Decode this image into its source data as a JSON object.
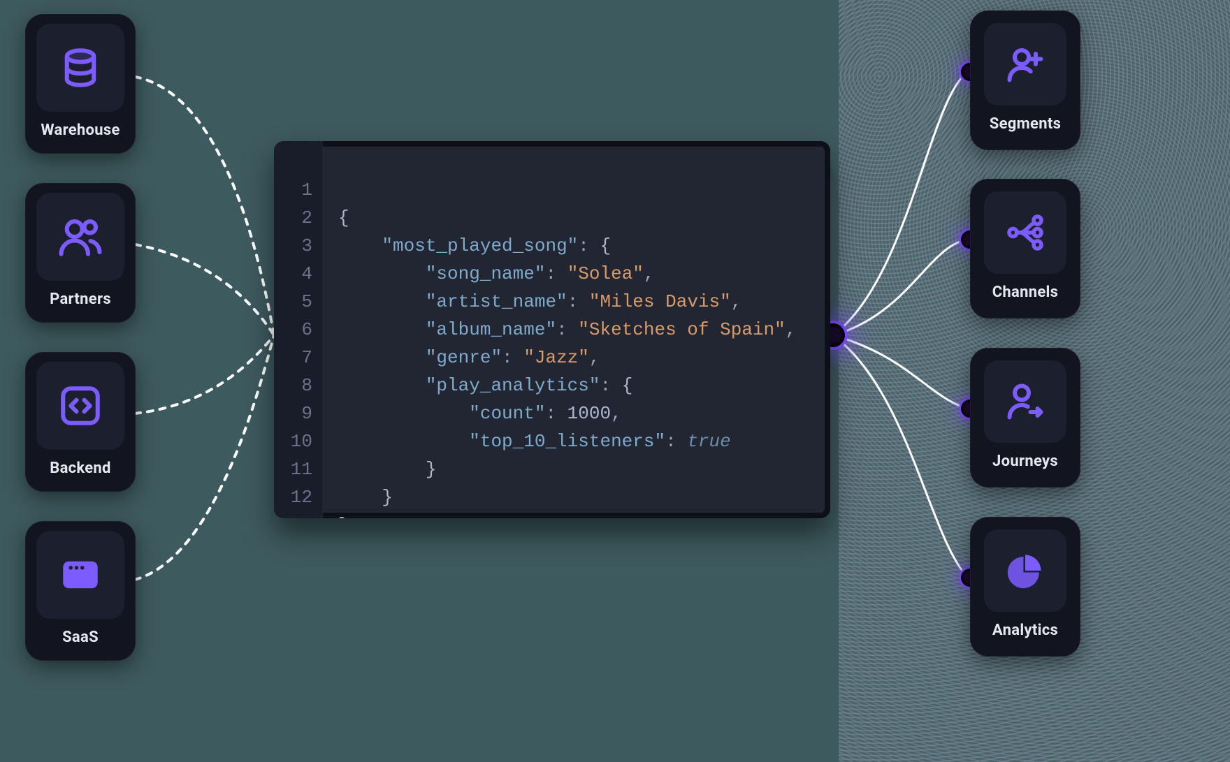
{
  "sources": [
    {
      "id": "warehouse",
      "label": "Warehouse",
      "icon": "database-icon"
    },
    {
      "id": "partners",
      "label": "Partners",
      "icon": "people-icon"
    },
    {
      "id": "backend",
      "label": "Backend",
      "icon": "code-box-icon"
    },
    {
      "id": "saas",
      "label": "SaaS",
      "icon": "browser-icon"
    }
  ],
  "destinations": [
    {
      "id": "segments",
      "label": "Segments",
      "icon": "person-plus-icon"
    },
    {
      "id": "channels",
      "label": "Channels",
      "icon": "network-icon"
    },
    {
      "id": "journeys",
      "label": "Journeys",
      "icon": "person-arrow-icon"
    },
    {
      "id": "analytics",
      "label": "Analytics",
      "icon": "pie-chart-icon"
    }
  ],
  "code": {
    "line_count": 12,
    "json": {
      "most_played_song": {
        "song_name": "Solea",
        "artist_name": "Miles Davis",
        "album_name": "Sketches of Spain",
        "genre": "Jazz",
        "play_analytics": {
          "count": 1000,
          "top_10_listeners": true
        }
      }
    },
    "keys": {
      "most_played_song": "\"most_played_song\"",
      "song_name": "\"song_name\"",
      "artist_name": "\"artist_name\"",
      "album_name": "\"album_name\"",
      "genre": "\"genre\"",
      "play_analytics": "\"play_analytics\"",
      "count": "\"count\"",
      "top_10_listeners": "\"top_10_listeners\""
    },
    "values": {
      "song_name": "\"Solea\"",
      "artist_name": "\"Miles Davis\"",
      "album_name": "\"Sketches of Spain\"",
      "genre": "\"Jazz\"",
      "count": "1000",
      "top_10_listeners": "true"
    }
  },
  "colors": {
    "accent": "#7c5cff",
    "bg": "#3d5a5e",
    "panel": "#222633",
    "card": "#12141f",
    "tile": "#1b1f2e"
  }
}
